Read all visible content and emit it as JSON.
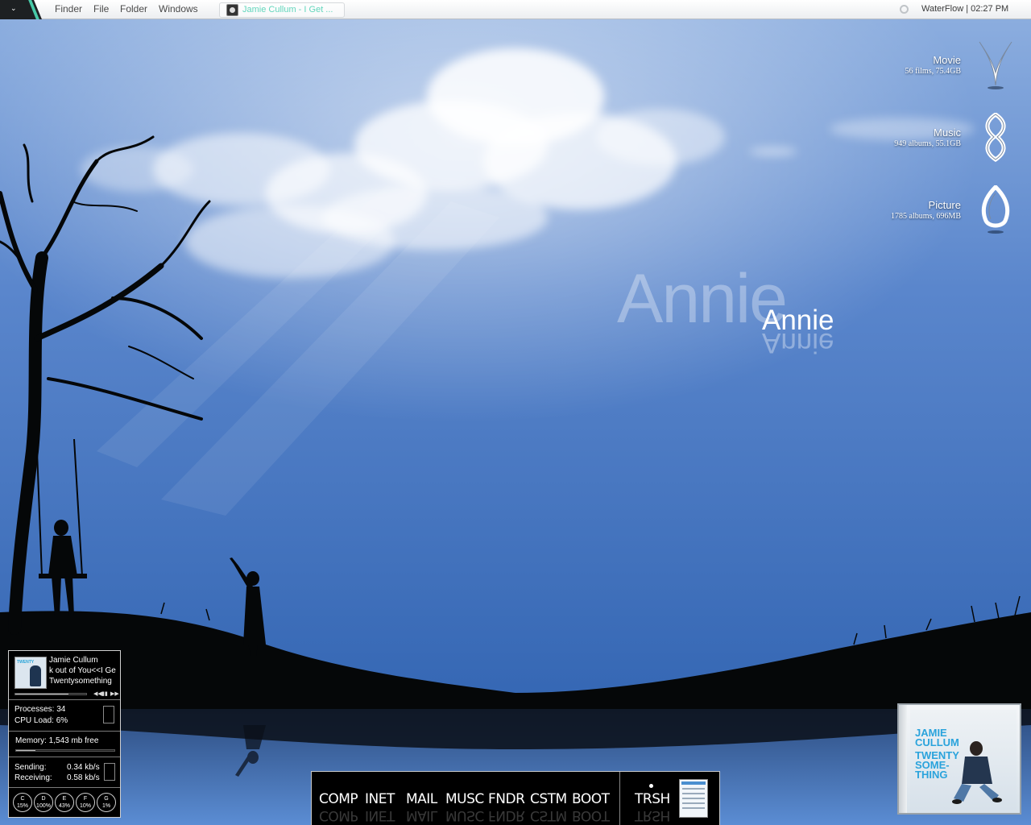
{
  "menubar": {
    "menu_items": [
      "Finder",
      "File",
      "Folder",
      "Windows"
    ],
    "task_label": "Jamie Cullum - I Get ...",
    "status_text": "WaterFlow | 02:27 PM"
  },
  "desktop": {
    "title_large": "Annie",
    "title_small": "Annie"
  },
  "launchers": [
    {
      "title": "Movie",
      "subtitle": "56 films, 75.4GB",
      "icon": "movie-icon"
    },
    {
      "title": "Music",
      "subtitle": "949 albums, 55.1GB",
      "icon": "music-icon"
    },
    {
      "title": "Picture",
      "subtitle": "1785 albums, 696MB",
      "icon": "picture-icon"
    }
  ],
  "now_playing": {
    "artist": "Jamie Cullum",
    "track": "k out of You<<I Ge",
    "album": "Twentysomething",
    "album_thumb_text": "TWENTY",
    "progress": 0.75,
    "controls": [
      "◀◀",
      "▮▮",
      "▶▶"
    ]
  },
  "system": {
    "processes_label": "Processes: 34",
    "cpu_label": "CPU Load: 6%",
    "memory_label": "Memory: 1,543 mb free",
    "memory_used_fraction": 0.2,
    "sending_label": "Sending:",
    "sending_value": "0.34 kb/s",
    "receiving_label": "Receiving:",
    "receiving_value": "0.58 kb/s"
  },
  "drives": [
    {
      "letter": "C",
      "percent": "15%"
    },
    {
      "letter": "D",
      "percent": "100%"
    },
    {
      "letter": "E",
      "percent": "43%"
    },
    {
      "letter": "F",
      "percent": "10%"
    },
    {
      "letter": "G",
      "percent": "1%"
    }
  ],
  "dock": {
    "items": [
      "COMP",
      "INET",
      "MAIL",
      "MUSC",
      "FNDR",
      "CSTM",
      "BOOT"
    ],
    "trash_label": "TRSH"
  },
  "album_cover": {
    "lines": [
      "JAMIE",
      "CULLUM",
      "TWENTY",
      "SOME-",
      "THING"
    ]
  },
  "colors": {
    "sky_top": "#a9c1e8",
    "sky_mid": "#4a7cc6",
    "accent_teal": "#47c9a7",
    "cover_blue": "#2aa3dc"
  }
}
